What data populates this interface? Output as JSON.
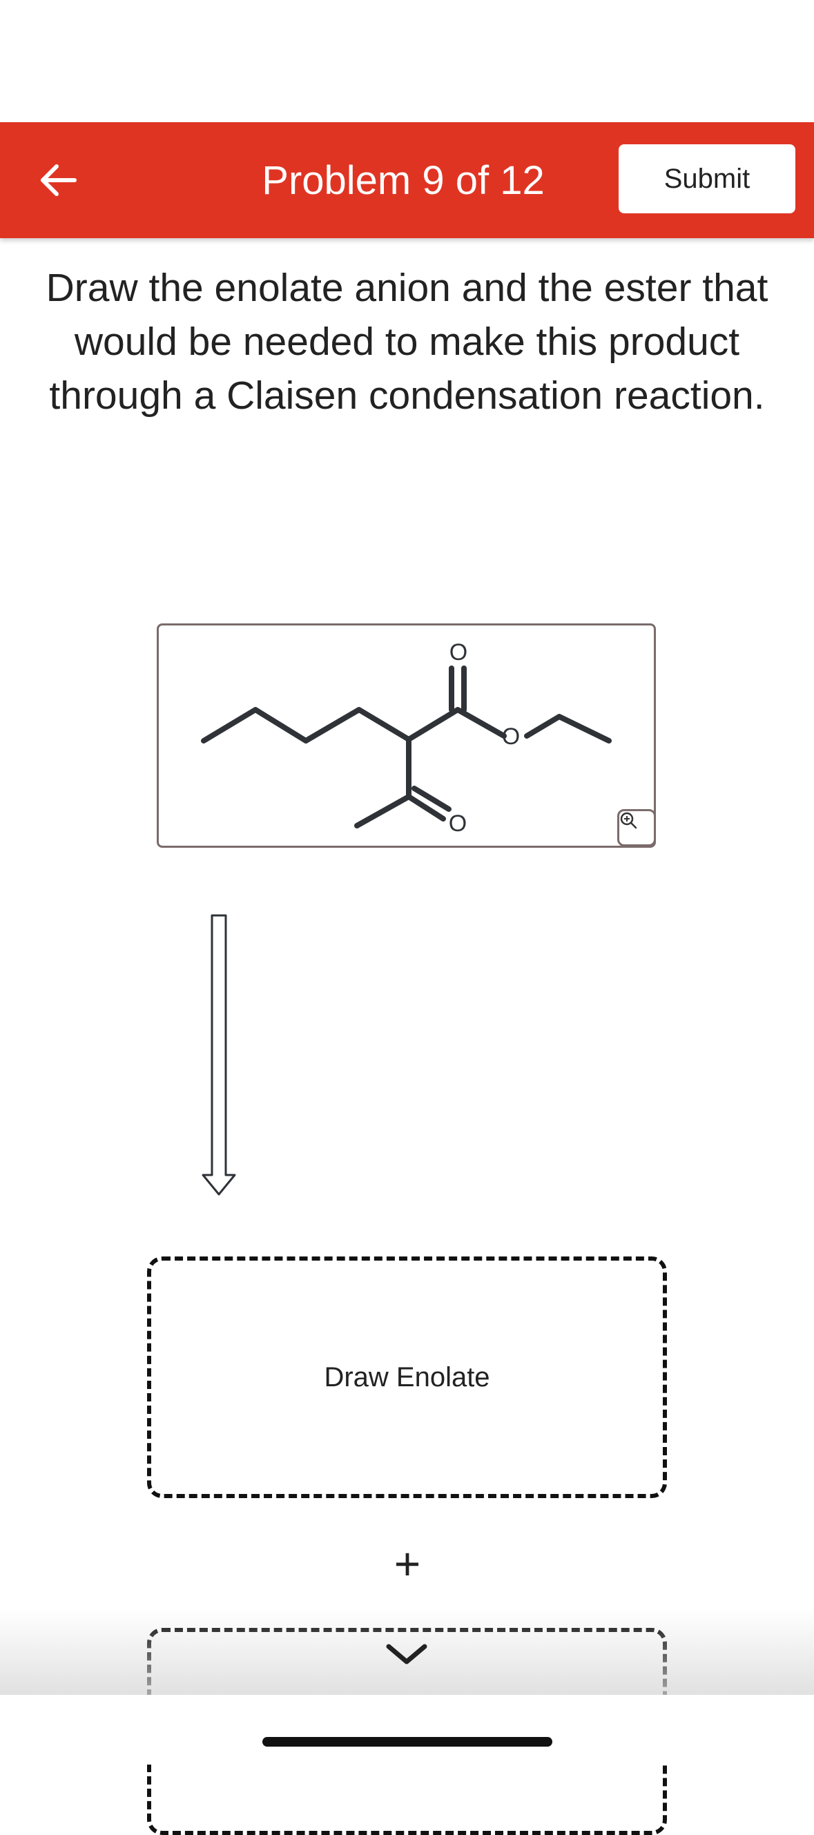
{
  "header": {
    "title": "Problem 9 of 12",
    "submit_label": "Submit",
    "back_icon": "arrow-left-icon",
    "background_color": "#e03423"
  },
  "question": {
    "text": "Draw the enolate anion and the ester that would be needed to make this product through a Claisen condensation reaction."
  },
  "product": {
    "atom_labels": [
      "O",
      "O",
      "O"
    ],
    "zoom_icon": "zoom-in-icon"
  },
  "reaction_arrow_icon": "hollow-down-arrow-icon",
  "enolate_zone": {
    "label": "Draw Enolate"
  },
  "plus_sign": "+",
  "scroll_icon": "chevron-down-icon"
}
